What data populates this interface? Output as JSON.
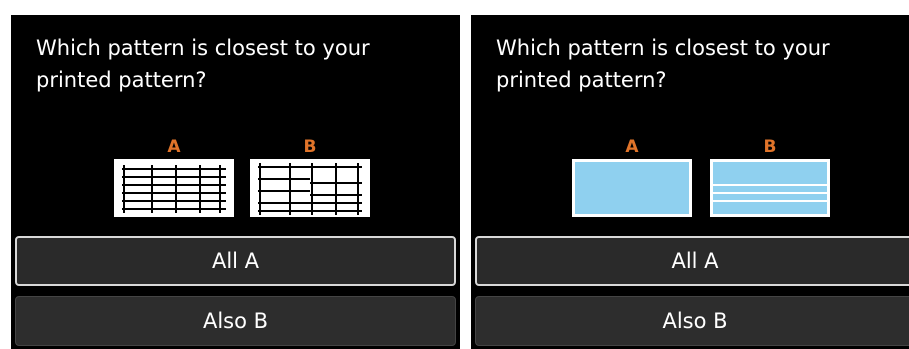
{
  "colors": {
    "screen_bg": "#000000",
    "label_color": "#e0742a",
    "button_bg": "#2b2b2b",
    "button_selected_border": "#d8d8d8",
    "pattern_fill_blue": "#8fd0ef",
    "pattern_line_white": "#ffffff"
  },
  "screens": [
    {
      "question": "Which pattern is closest to your printed pattern?",
      "patterns": [
        {
          "label": "A",
          "style": "grid-lines"
        },
        {
          "label": "B",
          "style": "grid-lines-misaligned"
        }
      ],
      "buttons": [
        {
          "label": "All A",
          "selected": true
        },
        {
          "label": "Also B",
          "selected": false
        }
      ]
    },
    {
      "question": "Which pattern is closest to your printed pattern?",
      "patterns": [
        {
          "label": "A",
          "style": "solid-blue"
        },
        {
          "label": "B",
          "style": "blue-striped"
        }
      ],
      "buttons": [
        {
          "label": "All A",
          "selected": true
        },
        {
          "label": "Also B",
          "selected": false
        }
      ]
    }
  ]
}
